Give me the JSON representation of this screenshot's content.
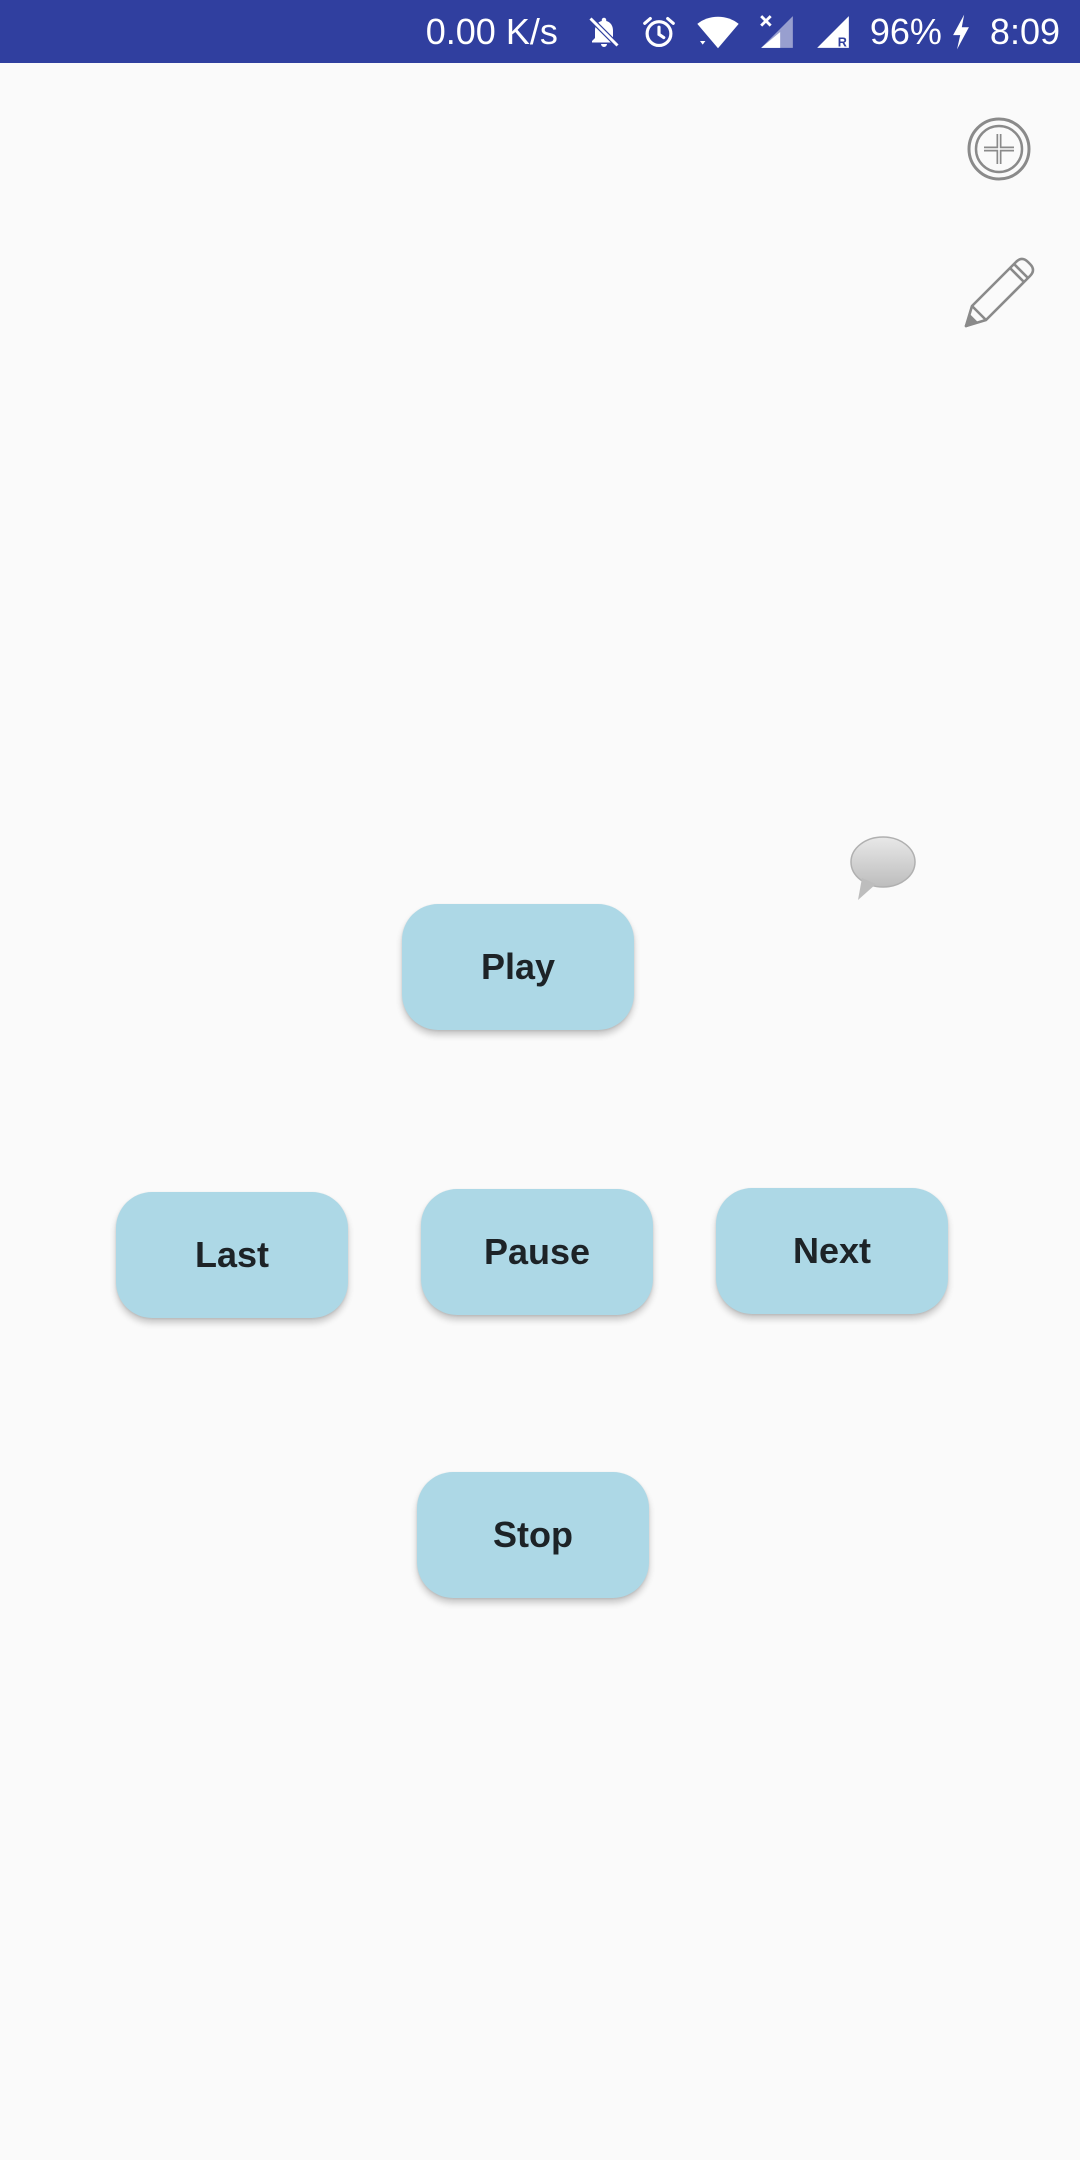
{
  "status_bar": {
    "network_speed": "0.00 K/s",
    "battery_percent": "96%",
    "time": "8:09",
    "icons": [
      "bell-off-icon",
      "alarm-icon",
      "wifi-icon",
      "signal-x-icon",
      "signal-r-icon",
      "charging-icon"
    ]
  },
  "toolbar": {
    "add_icon": "add-circle-icon",
    "edit_icon": "pencil-icon"
  },
  "overlay": {
    "speech_icon": "speech-bubble-icon"
  },
  "controls": {
    "play_label": "Play",
    "last_label": "Last",
    "pause_label": "Pause",
    "next_label": "Next",
    "stop_label": "Stop"
  },
  "colors": {
    "status_bar": "#303f9f",
    "button_bg": "#add8e6",
    "button_text": "#1d2327",
    "background": "#fafafa"
  }
}
